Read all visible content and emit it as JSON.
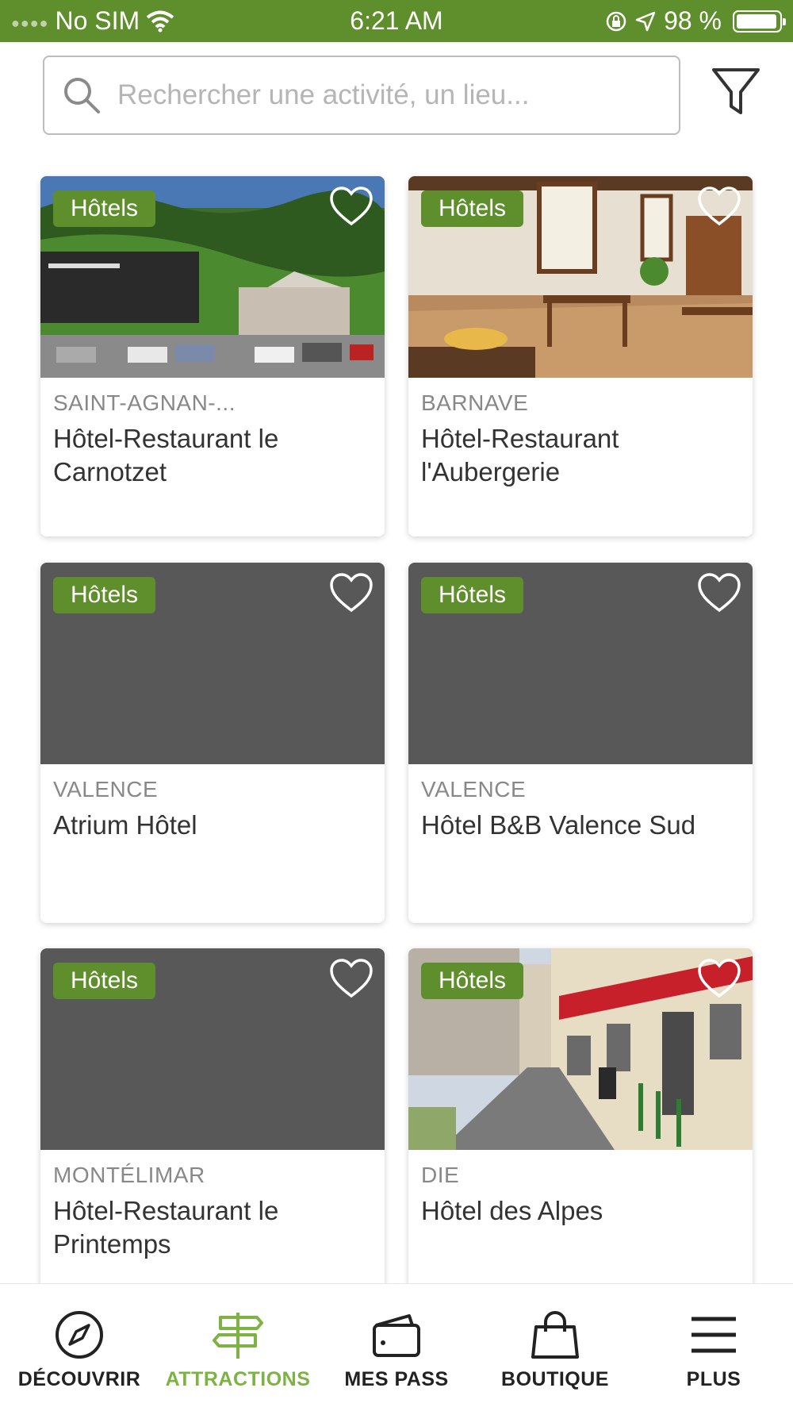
{
  "status_bar": {
    "carrier": "No SIM",
    "time": "6:21 AM",
    "battery": "98 %"
  },
  "search": {
    "placeholder": "Rechercher une activité, un lieu..."
  },
  "listings": [
    {
      "category": "Hôtels",
      "city": "SAINT-AGNAN-...",
      "name": "Hôtel-Restaurant le Carnotzet"
    },
    {
      "category": "Hôtels",
      "city": "BARNAVE",
      "name": "Hôtel-Restaurant l'Aubergerie"
    },
    {
      "category": "Hôtels",
      "city": "VALENCE",
      "name": "Atrium Hôtel"
    },
    {
      "category": "Hôtels",
      "city": "VALENCE",
      "name": "Hôtel B&B Valence Sud"
    },
    {
      "category": "Hôtels",
      "city": "MONTÉLIMAR",
      "name": "Hôtel-Restaurant le Printemps"
    },
    {
      "category": "Hôtels",
      "city": "DIE",
      "name": "Hôtel des Alpes"
    }
  ],
  "nav": [
    {
      "label": "DÉCOUVRIR",
      "icon": "compass-icon",
      "active": false
    },
    {
      "label": "ATTRACTIONS",
      "icon": "signpost-icon",
      "active": true
    },
    {
      "label": "MES PASS",
      "icon": "wallet-icon",
      "active": false
    },
    {
      "label": "BOUTIQUE",
      "icon": "shopping-bag-icon",
      "active": false
    },
    {
      "label": "PLUS",
      "icon": "menu-icon",
      "active": false
    }
  ],
  "colors": {
    "brand_green": "#5f8f2c",
    "active_nav": "#7cb342",
    "placeholder_bg": "#585858"
  }
}
